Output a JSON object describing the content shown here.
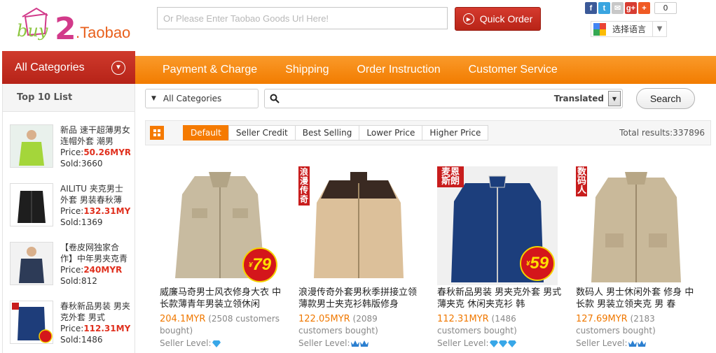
{
  "header": {
    "logo_text": "buy2Taobao",
    "url_placeholder": "Or Please Enter Taobao Goods Url Here!",
    "quick_order_label": "Quick Order",
    "share_count": "0",
    "language_label": "选择语言"
  },
  "nav": {
    "all_categories_label": "All Categories",
    "items": [
      {
        "label": "Payment & Charge"
      },
      {
        "label": "Shipping"
      },
      {
        "label": "Order Instruction"
      },
      {
        "label": "Customer Service"
      }
    ]
  },
  "sidebar": {
    "title": "Top 10 List",
    "items": [
      {
        "name": "新品 速干超薄男女连帽外套 潮男",
        "price_label": "Price:",
        "price": "50.26MYR",
        "sold": "Sold:3660"
      },
      {
        "name": "AILITU 夹克男士外套 男装春秋薄",
        "price_label": "Price:",
        "price": "132.31MYR",
        "sold": "Sold:1369"
      },
      {
        "name": "【卷皮网独家合作】中年男夹克青仑",
        "price_label": "Price:",
        "price": "240MYR",
        "sold": "Sold:812"
      },
      {
        "name": "春秋新品男装 男夹克外套 男式",
        "price_label": "Price:",
        "price": "112.31MYR",
        "sold": "Sold:1486"
      }
    ]
  },
  "search": {
    "category_label": "All Categories",
    "input_value": "",
    "translated_label": "Translated",
    "search_label": "Search"
  },
  "sort": {
    "options": [
      {
        "label": "Default"
      },
      {
        "label": "Seller Credit"
      },
      {
        "label": "Best Selling"
      },
      {
        "label": "Lower Price"
      },
      {
        "label": "Higher Price"
      }
    ],
    "total_label": "Total results:337896"
  },
  "products": [
    {
      "title": "威廉马奇男士风衣修身大衣 中长款薄青年男装立领休闲",
      "price": "204.1MYR",
      "customers": "(2508 customers bought)",
      "seller_level_label": "Seller Level:",
      "badge": "79",
      "tag": ""
    },
    {
      "title": "浪漫传奇外套男秋季拼接立领薄款男士夹克衫韩版修身",
      "price": "122.05MYR",
      "customers": "(2089 customers bought)",
      "seller_level_label": "Seller Level:",
      "badge": "",
      "tag": "浪漫传奇"
    },
    {
      "title": "春秋新品男装 男夹克外套 男式薄夹克 休闲夹克衫 韩",
      "price": "112.31MYR",
      "customers": "(1486 customers bought)",
      "seller_level_label": "Seller Level:",
      "badge": "59",
      "tag": "麦恩斯朗"
    },
    {
      "title": "数码人 男士休闲外套 修身 中长款 男装立领夹克 男 春",
      "price": "127.69MYR",
      "customers": "(2183 customers bought)",
      "seller_level_label": "Seller Level:",
      "badge": "",
      "tag": "数码人"
    }
  ],
  "colors": {
    "accent_red": "#c62a1d",
    "nav_orange": "#f58a10",
    "price_orange": "#f07800"
  }
}
